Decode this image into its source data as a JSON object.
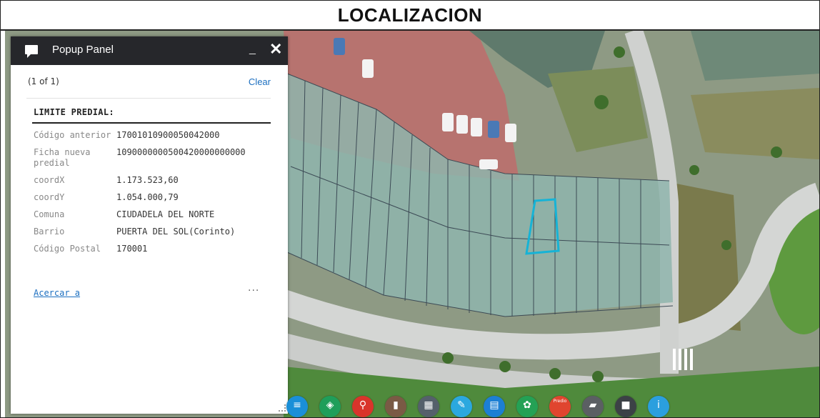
{
  "header": {
    "title": "LOCALIZACION"
  },
  "popup": {
    "title": "Popup Panel",
    "minimize_label": "_",
    "close_label": "✕",
    "pager": "(1 of 1)",
    "clear_label": "Clear",
    "section_title": "LIMITE PREDIAL:",
    "attributes": [
      {
        "key": "Código anterior",
        "value": "17001010900050042000"
      },
      {
        "key": "Ficha nueva predial",
        "value": "1090000000500420000000000"
      },
      {
        "key": "coordX",
        "value": "1.173.523,60"
      },
      {
        "key": "coordY",
        "value": "1.054.000,79"
      },
      {
        "key": "Comuna",
        "value": "CIUDADELA DEL NORTE"
      },
      {
        "key": "Barrio",
        "value": "PUERTA DEL SOL(Corinto)"
      },
      {
        "key": "Código Postal",
        "value": "170001"
      }
    ],
    "zoom_label": "Acercar a",
    "more_label": "···"
  },
  "toolbar": {
    "tools": [
      {
        "name": "list-icon",
        "color": "#1a8fd8"
      },
      {
        "name": "layers-icon",
        "color": "#1f9e5a"
      },
      {
        "name": "search-location-icon",
        "color": "#d9342b"
      },
      {
        "name": "pin-icon",
        "color": "#7a5a45"
      },
      {
        "name": "measure-icon",
        "color": "#55606b"
      },
      {
        "name": "draw-icon",
        "color": "#2ba8df"
      },
      {
        "name": "print-icon",
        "color": "#1c7fd4"
      },
      {
        "name": "analysis-icon",
        "color": "#24a155"
      },
      {
        "name": "home-icon",
        "color": "#e0452f",
        "label": "Predio"
      },
      {
        "name": "basemap-icon",
        "color": "#5b5f63"
      },
      {
        "name": "table-icon",
        "color": "#3c4146"
      },
      {
        "name": "info-icon",
        "color": "#2b9fde"
      }
    ]
  }
}
